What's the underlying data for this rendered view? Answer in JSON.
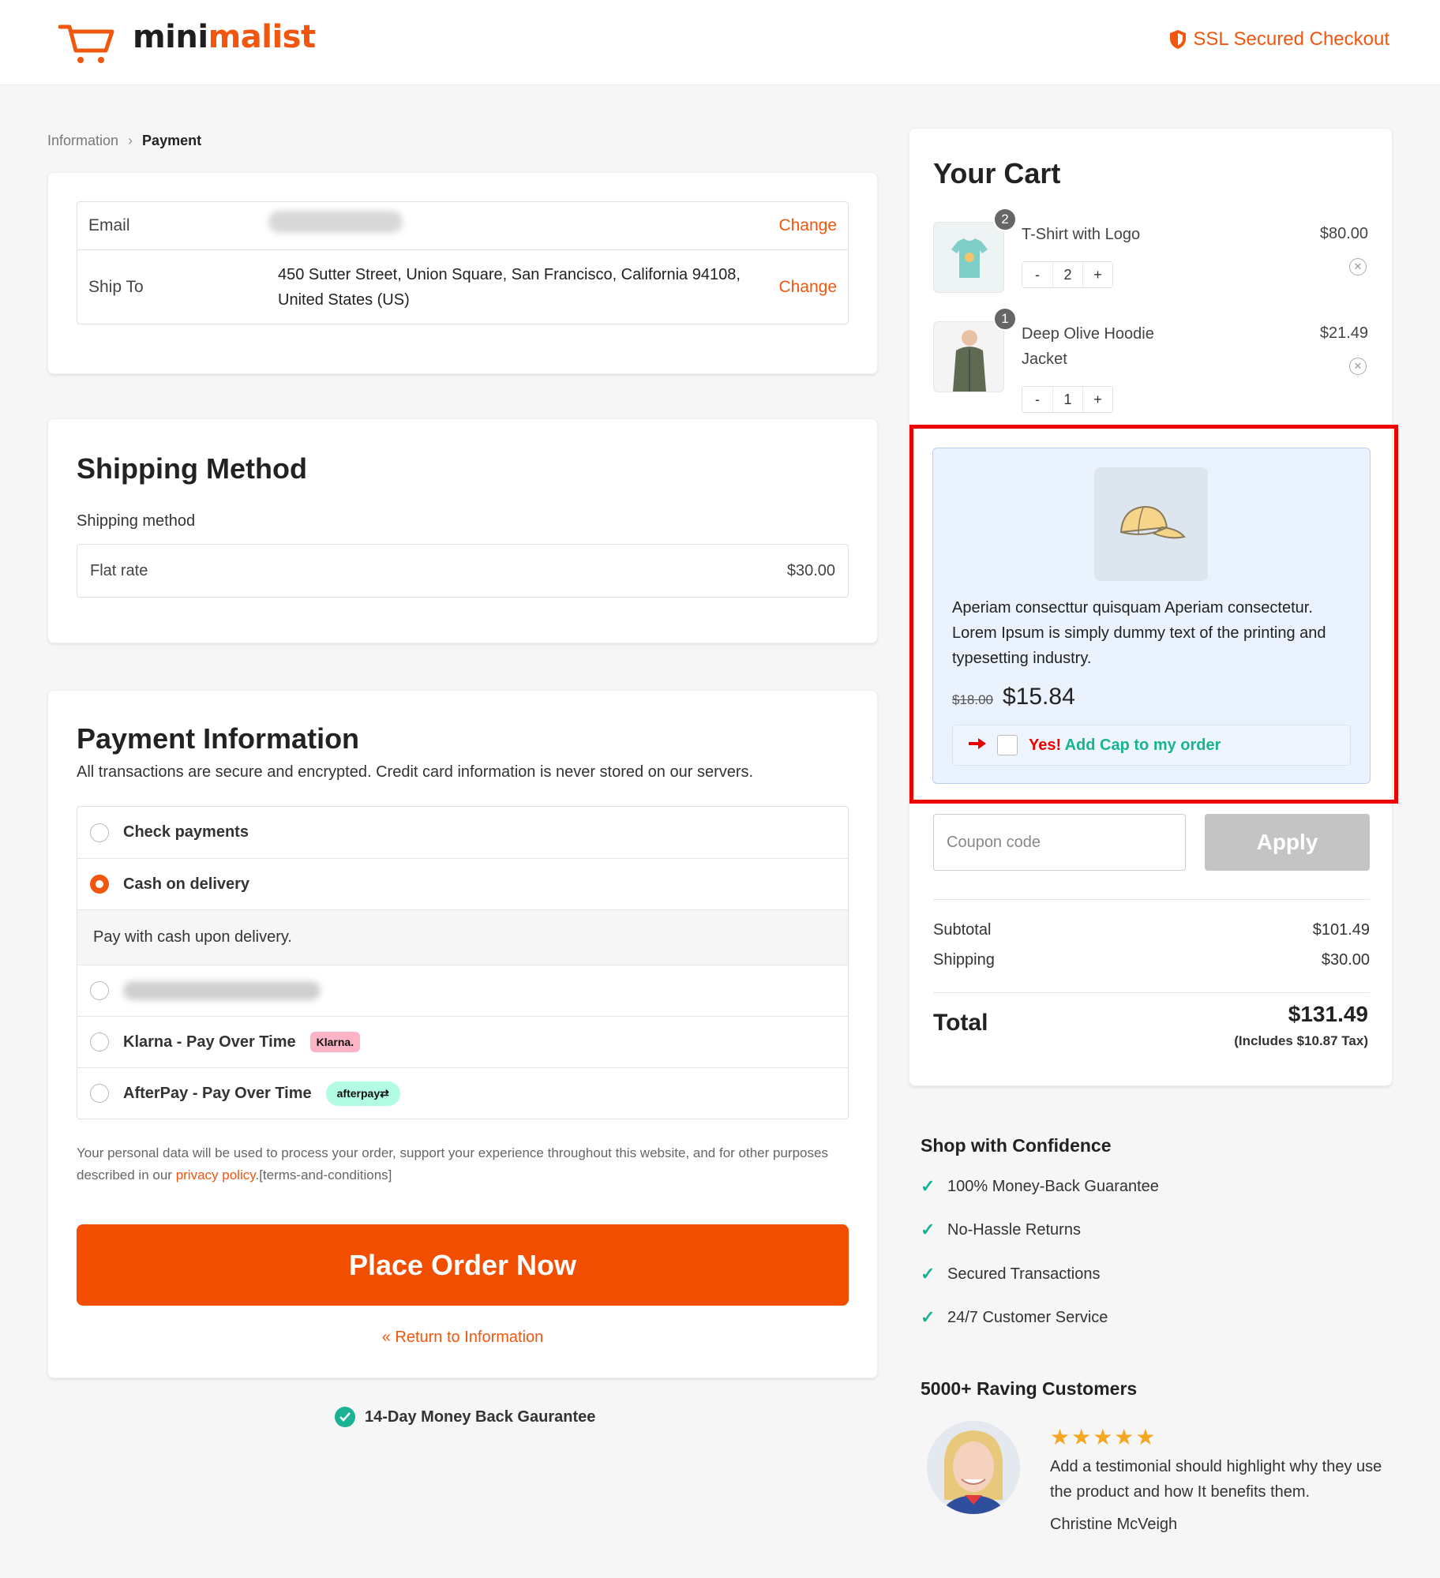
{
  "brand": {
    "logo_part1": "mini",
    "logo_part2": "malist",
    "primary": "#f0560e",
    "accent_green": "#19b394"
  },
  "header": {
    "ssl_label": "SSL Secured Checkout"
  },
  "breadcrumb": {
    "step1": "Information",
    "step2": "Payment"
  },
  "contact": {
    "email_label": "Email",
    "email_value": "",
    "ship_label": "Ship To",
    "ship_value_line1": "450 Sutter Street, Union Square, San Francisco, California 94108,",
    "ship_value_line2": "United States (US)",
    "change_label": "Change"
  },
  "shipping": {
    "title": "Shipping Method",
    "label": "Shipping method",
    "option_name": "Flat rate",
    "option_price": "$30.00"
  },
  "payment": {
    "title": "Payment Information",
    "subtitle": "All transactions are secure and encrypted. Credit card information is never stored on our servers.",
    "methods": [
      {
        "label": "Check payments",
        "selected": false
      },
      {
        "label": "Cash on delivery",
        "selected": true
      },
      {
        "label": "",
        "selected": false
      },
      {
        "label": "Klarna - Pay Over Time",
        "badge": "Klarna.",
        "selected": false
      },
      {
        "label": "AfterPay - Pay Over Time",
        "badge": "afterpay⇄",
        "selected": false
      }
    ],
    "cod_description": "Pay with cash upon delivery.",
    "privacy_text_1": "Your personal data will be used to process your order, support your experience throughout this website, and for other purposes described in our ",
    "privacy_link": "privacy policy",
    "privacy_text_2": ".[terms-and-conditions]",
    "place_order": "Place Order Now",
    "return_link": "« Return to Information",
    "guarantee": "14-Day Money Back Gaurantee"
  },
  "cart": {
    "title": "Your Cart",
    "items": [
      {
        "name": "T-Shirt with Logo",
        "price": "$80.00",
        "qty": "2",
        "badge": "2"
      },
      {
        "name_line1": "Deep Olive Hoodie",
        "name_line2": "Jacket",
        "price": "$21.49",
        "qty": "1",
        "badge": "1"
      }
    ],
    "stepper_minus": "-",
    "stepper_plus": "+",
    "bump": {
      "description": "Aperiam consecttur quisquam Aperiam consectetur. Lorem Ipsum is simply dummy text of the printing and typesetting industry.",
      "old_price": "$18.00",
      "new_price": "$15.84",
      "cta_yes": "Yes!",
      "cta_add": "Add Cap to my order"
    },
    "coupon_placeholder": "Coupon code",
    "apply_label": "Apply",
    "subtotal_label": "Subtotal",
    "subtotal_value": "$101.49",
    "shipping_label": "Shipping",
    "shipping_value": "$30.00",
    "total_label": "Total",
    "total_value": "$131.49",
    "tax_note": "(Includes $10.87 Tax)"
  },
  "confidence": {
    "title": "Shop with Confidence",
    "items": [
      "100% Money-Back Guarantee",
      "No-Hassle Returns",
      "Secured Transactions",
      "24/7 Customer Service"
    ]
  },
  "reviews": {
    "title": "5000+ Raving Customers",
    "stars": "★★★★★",
    "rating": 5,
    "quote": "Add a testimonial should highlight why they use the product and how It benefits them.",
    "author": "Christine McVeigh"
  }
}
